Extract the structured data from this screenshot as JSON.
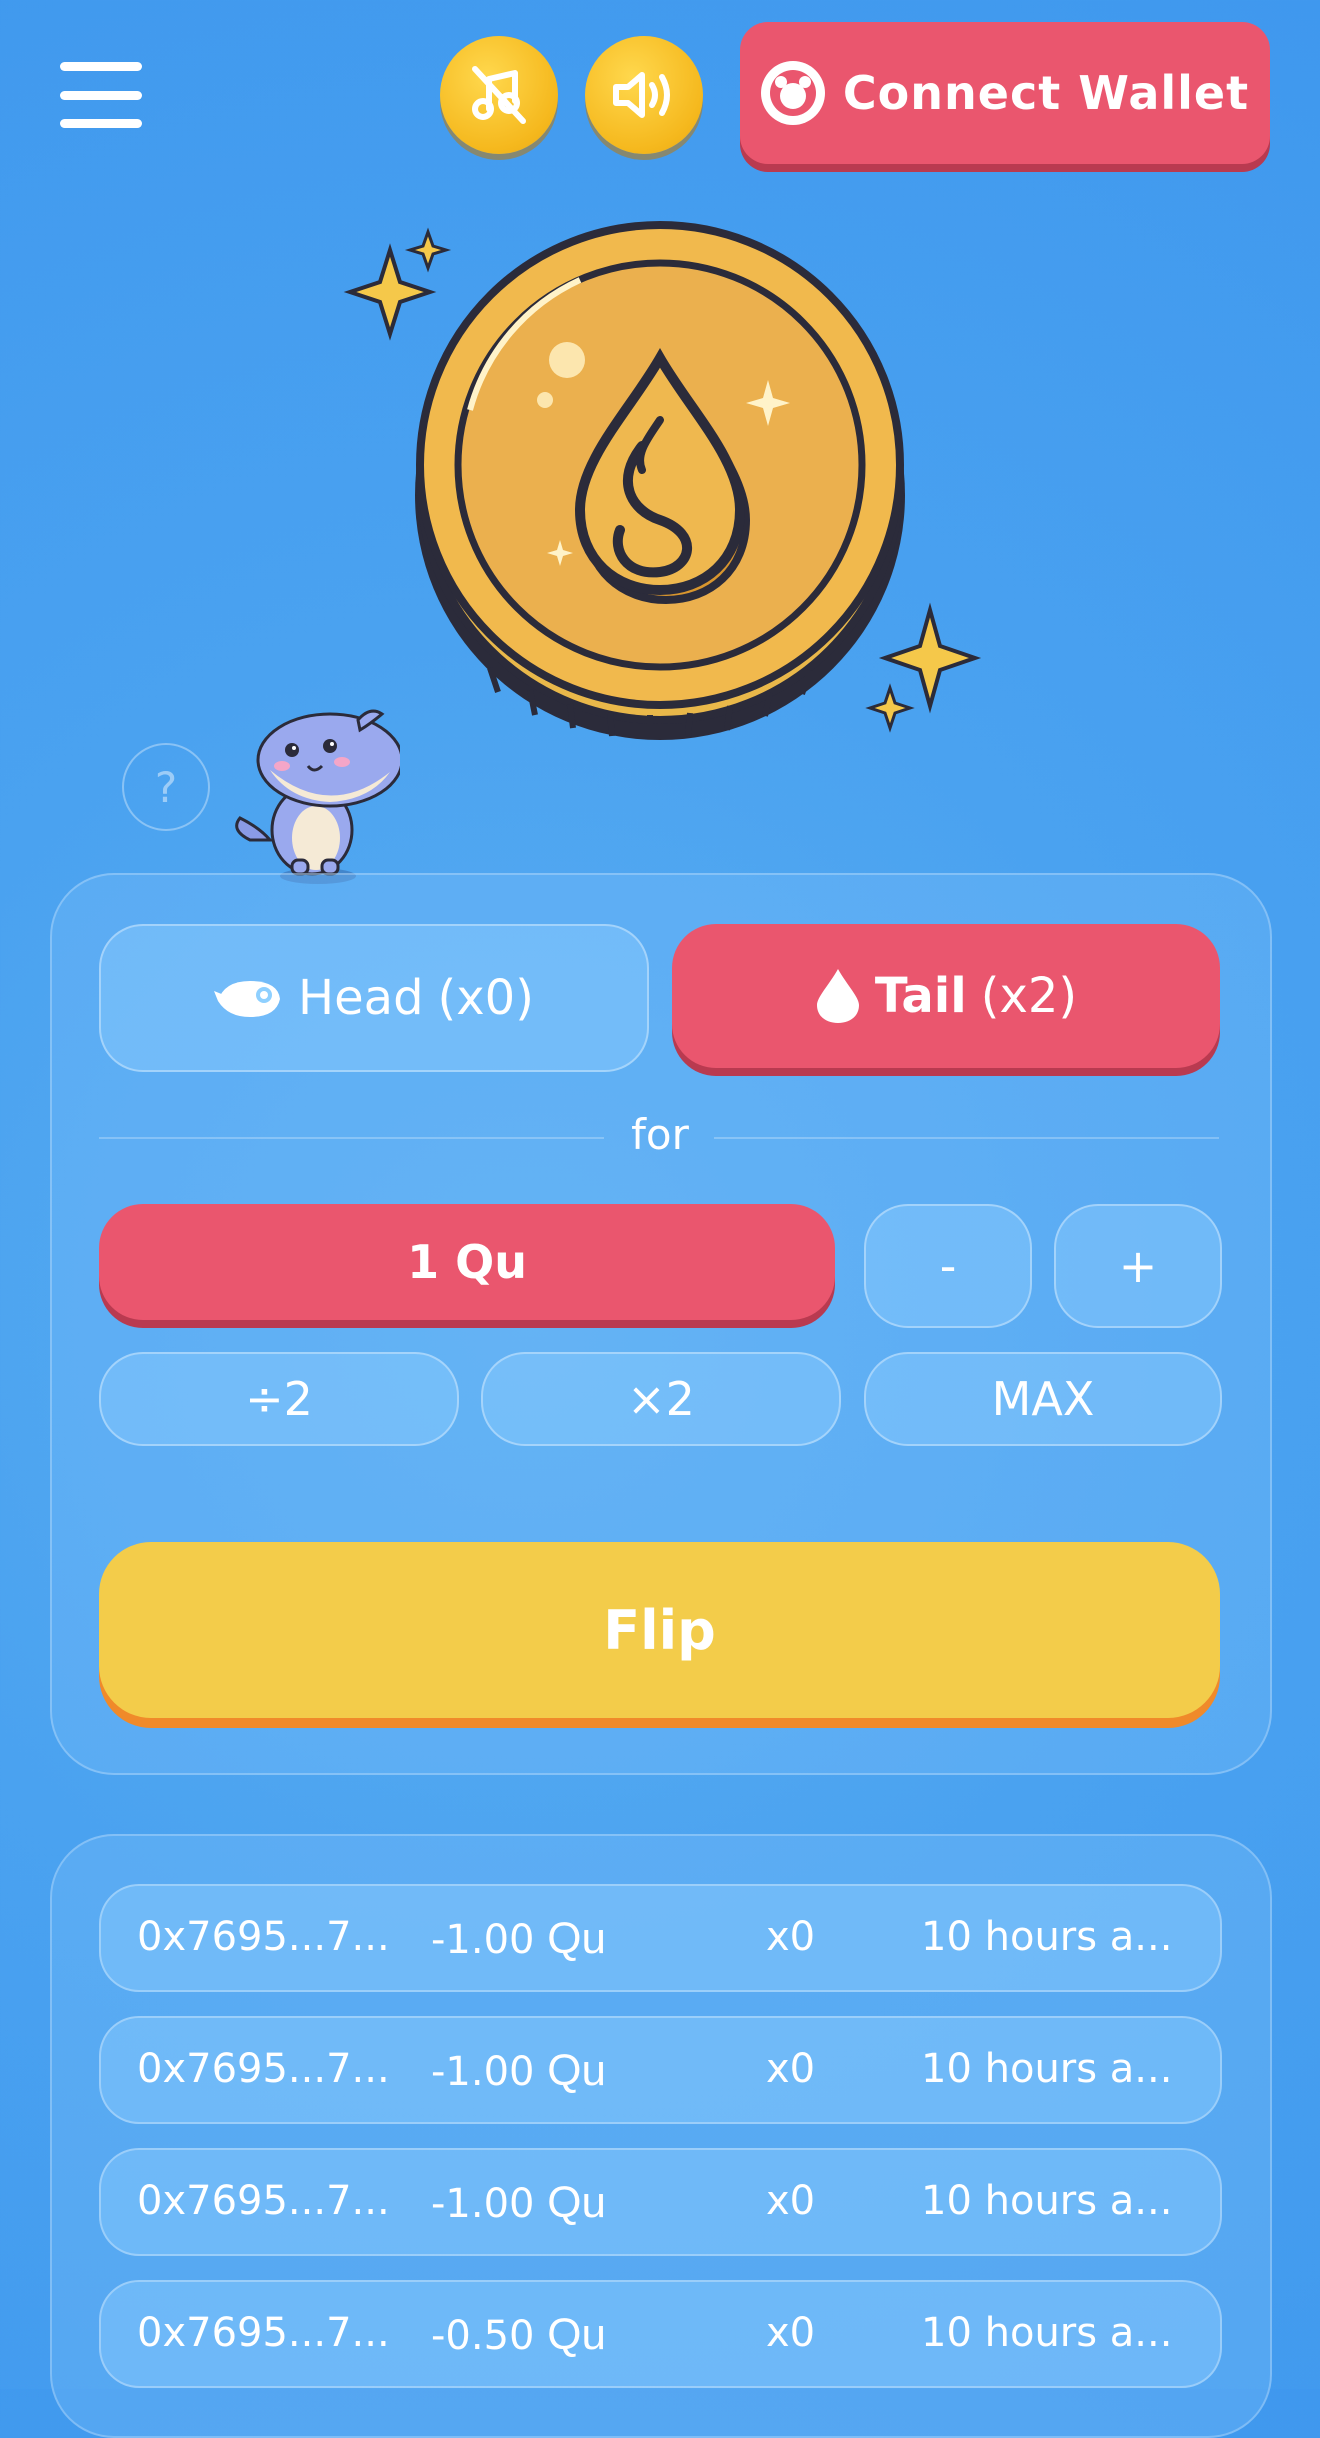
{
  "header": {
    "connect_wallet_label": "Connect Wallet",
    "menu_icon": "hamburger-menu-icon",
    "music_icon": "music-off-icon",
    "sound_icon": "speaker-on-icon"
  },
  "help": {
    "label": "?"
  },
  "game": {
    "head": {
      "label": "Head",
      "multiplier": "(x0)"
    },
    "tail": {
      "label": "Tail",
      "multiplier": "(x2)"
    },
    "for_label": "for",
    "amount": "1  Qu",
    "minus_label": "-",
    "plus_label": "+",
    "half_label": "÷2",
    "double_label": "×2",
    "max_label": "MAX",
    "flip_label": "Flip"
  },
  "history": {
    "rows": [
      {
        "address": "0x7695...7...",
        "amount": "-1.00",
        "unit": "Qu",
        "multiplier": "x0",
        "time": "10 hours a..."
      },
      {
        "address": "0x7695...7...",
        "amount": "-1.00",
        "unit": "Qu",
        "multiplier": "x0",
        "time": "10 hours a..."
      },
      {
        "address": "0x7695...7...",
        "amount": "-1.00",
        "unit": "Qu",
        "multiplier": "x0",
        "time": "10 hours a..."
      },
      {
        "address": "0x7695...7...",
        "amount": "-0.50",
        "unit": "Qu",
        "multiplier": "x0",
        "time": "10 hours a..."
      }
    ]
  },
  "colors": {
    "background": "#4aa2f0",
    "accent_red": "#ea566e",
    "flip_yellow": "#f3cc4a",
    "coin_gold": "#f0b84a"
  }
}
